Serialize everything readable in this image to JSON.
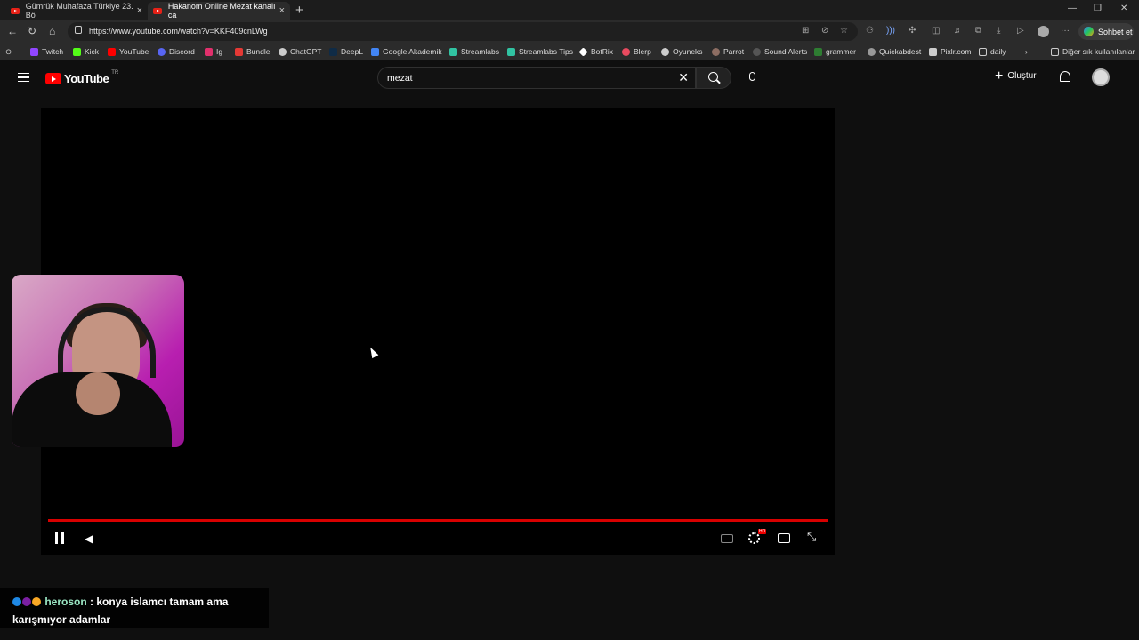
{
  "browser": {
    "tabs": [
      {
        "label": "Gümrük Muhafaza Türkiye 23. Bö",
        "active": false
      },
      {
        "label": "Hakanom Online Mezat kanalı ca",
        "active": true
      }
    ],
    "new_tab": "+",
    "url": "https://www.youtube.com/watch?v=KKF409cnLWg",
    "copilot_label": "Sohbet et",
    "bookmarks": [
      {
        "label": "Twitch",
        "color": "#9146ff"
      },
      {
        "label": "Kick",
        "color": "#53fc18"
      },
      {
        "label": "YouTube",
        "color": "#ff0000"
      },
      {
        "label": "Discord",
        "color": "#5865f2"
      },
      {
        "label": "Ig",
        "color": "#e1306c"
      },
      {
        "label": "Bundle",
        "color": "#e53935"
      },
      {
        "label": "ChatGPT",
        "color": "#cccccc"
      },
      {
        "label": "DeepL",
        "color": "#0f2b46"
      },
      {
        "label": "Google Akademik",
        "color": "#4285f4"
      },
      {
        "label": "Streamlabs",
        "color": "#31c3a2"
      },
      {
        "label": "Streamlabs Tips",
        "color": "#31c3a2"
      },
      {
        "label": "BotRix",
        "color": "#ffffff"
      },
      {
        "label": "Blerp",
        "color": "#e84a5f"
      },
      {
        "label": "Oyuneks",
        "color": "#cccccc"
      },
      {
        "label": "Parrot",
        "color": "#8d6e63"
      },
      {
        "label": "Sound Alerts",
        "color": "#555555"
      },
      {
        "label": "grammer",
        "color": "#2e7d32"
      },
      {
        "label": "Quickabdest",
        "color": "#999999"
      },
      {
        "label": "Pixlr.com",
        "color": "#cccccc"
      },
      {
        "label": "daily",
        "color": "#888888"
      }
    ],
    "bookmarks_more": "Diğer sık kullanılanlar"
  },
  "youtube": {
    "logo_text": "YouTube",
    "country_code": "TR",
    "search_query": "mezat",
    "create_label": "Oluştur"
  },
  "player": {
    "progress": 1.0,
    "accent_color": "#d80000"
  },
  "chat_overlay": {
    "username": "heroson",
    "message": ": konya islamcı tamam ama karışmıyor adamlar"
  }
}
